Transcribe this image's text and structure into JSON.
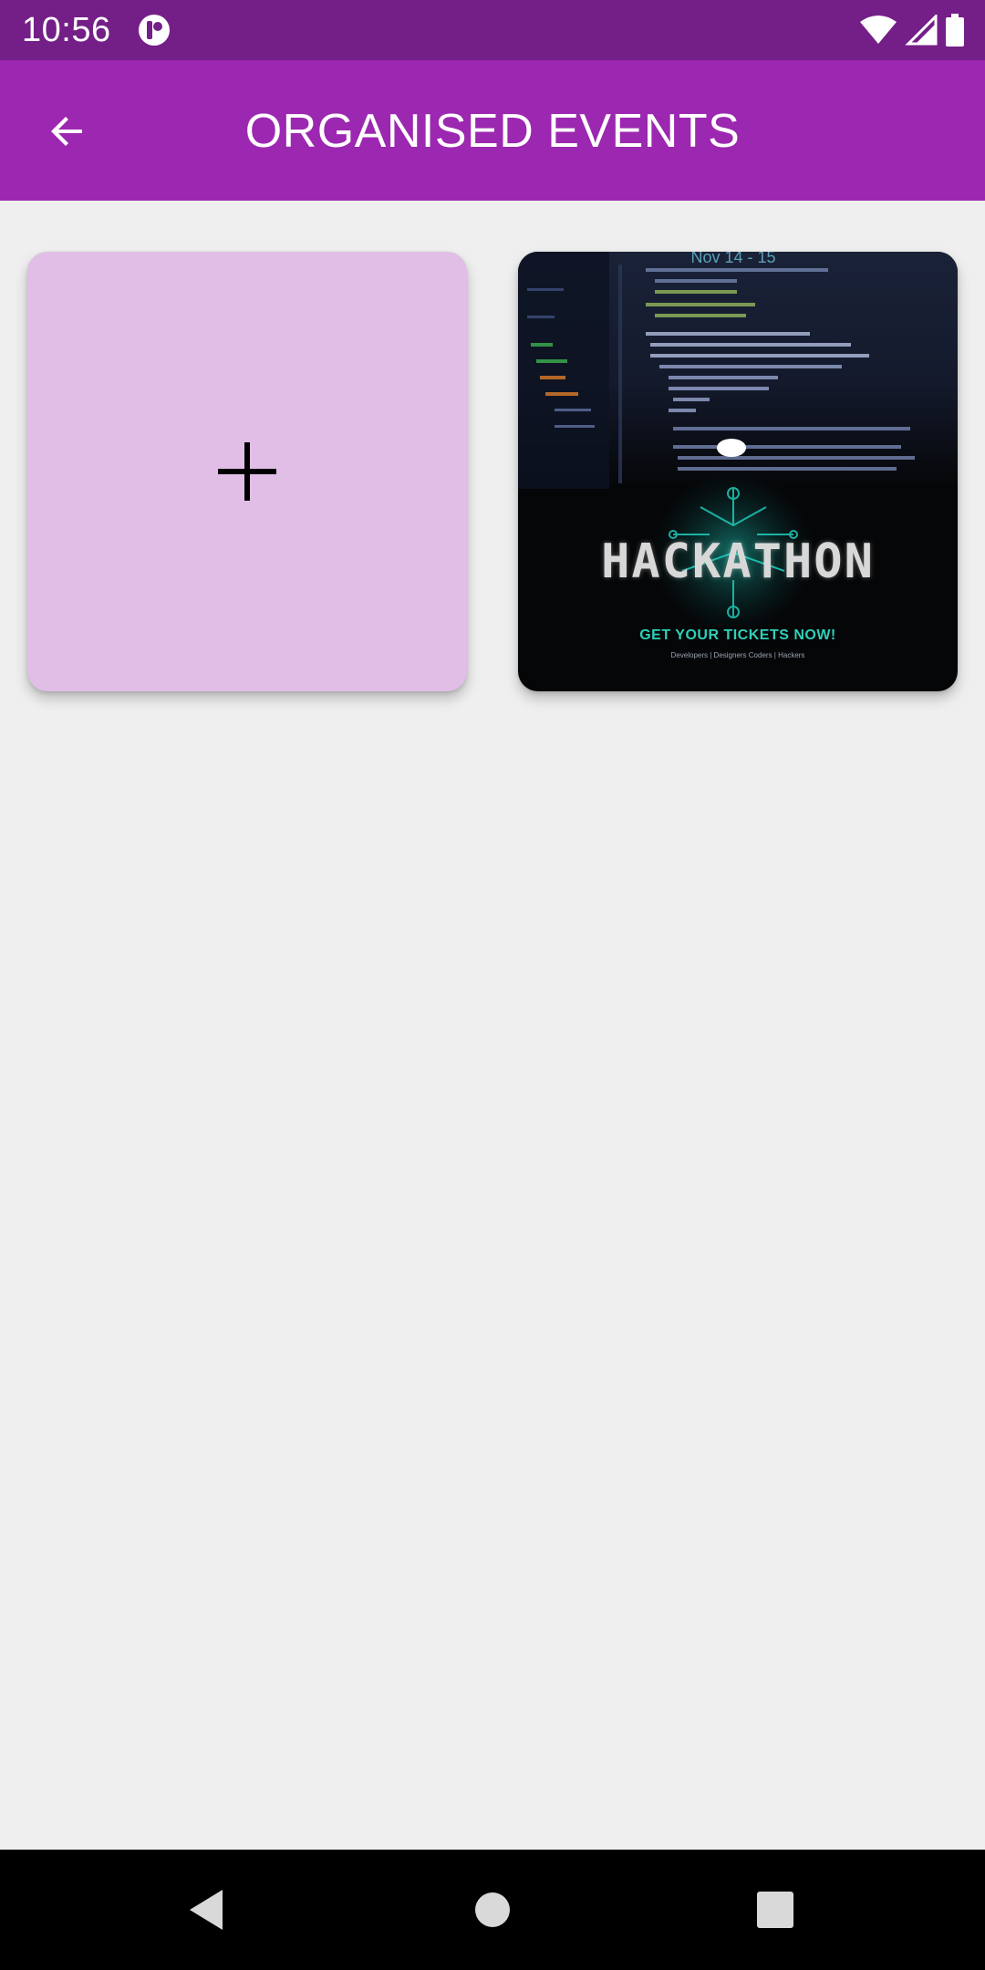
{
  "status_bar": {
    "time": "10:56",
    "icons": [
      "app-notification-icon",
      "wifi-icon",
      "signal-icon",
      "battery-icon"
    ]
  },
  "app_bar": {
    "title": "ORGANISED EVENTS",
    "back_icon": "arrow-back-icon",
    "background": "#9c27b0"
  },
  "events": {
    "add_card": {
      "icon": "plus-icon",
      "background": "#e0bee6"
    },
    "items": [
      {
        "poster": {
          "date": "Nov 14 - 15",
          "title": "HACKATHON",
          "cta": "GET YOUR TICKETS NOW!",
          "audience": "Developers | Designers Coders | Hackers"
        }
      }
    ]
  },
  "nav_bar": {
    "buttons": [
      "back-nav-icon",
      "home-nav-icon",
      "recents-nav-icon"
    ]
  }
}
